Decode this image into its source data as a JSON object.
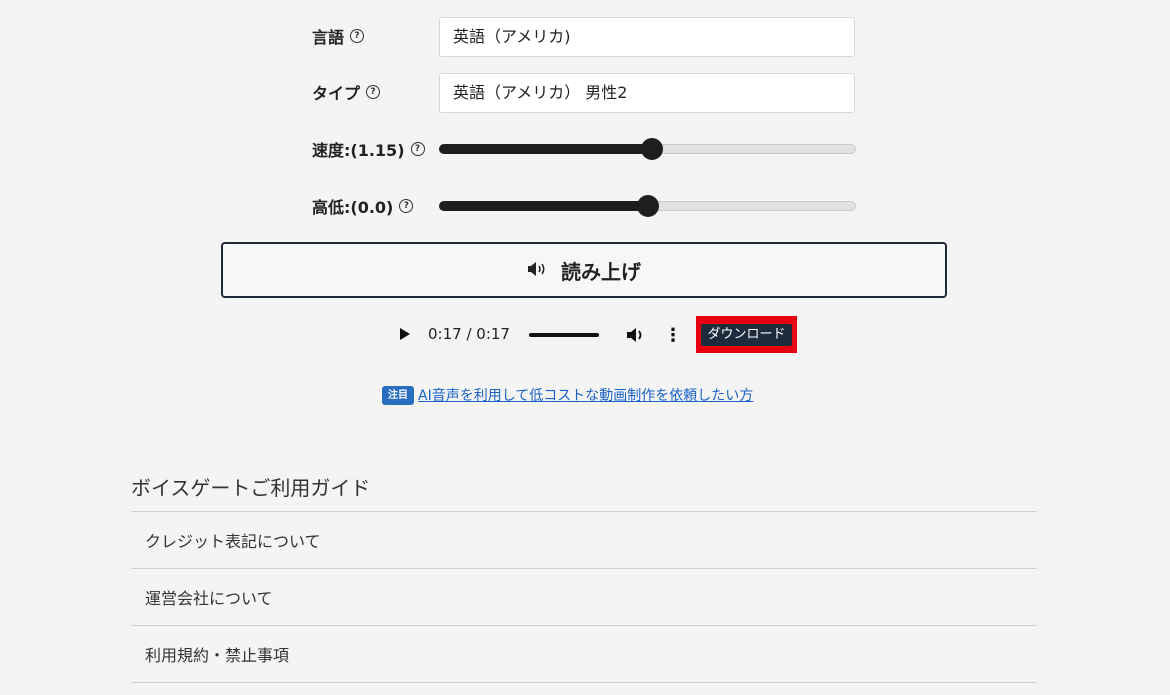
{
  "form": {
    "language": {
      "label": "言語",
      "value": "英語（アメリカ)"
    },
    "type": {
      "label": "タイプ",
      "value": "英語（アメリカ） 男性2"
    },
    "speed": {
      "label": "速度:(1.15)",
      "level_percent": 51
    },
    "pitch": {
      "label": "高低:(0.0)",
      "level_percent": 50
    },
    "help_glyph": "?"
  },
  "read_button": {
    "label": "読み上げ",
    "icon": "speaker-icon"
  },
  "player": {
    "time": "0:17 / 0:17",
    "progress_percent": 100
  },
  "download": {
    "label": "ダウンロード"
  },
  "notice": {
    "badge": "注目",
    "link": "AI音声を利用して低コストな動画制作を依頼したい方"
  },
  "guide": {
    "title": "ボイスゲートご利用ガイド",
    "items": [
      {
        "label": "クレジット表記について"
      },
      {
        "label": "運営会社について"
      },
      {
        "label": "利用規約・禁止事項"
      }
    ]
  },
  "colors": {
    "accent": "#1d2b3d",
    "highlight": "#e60012",
    "link": "#1a62c7"
  }
}
